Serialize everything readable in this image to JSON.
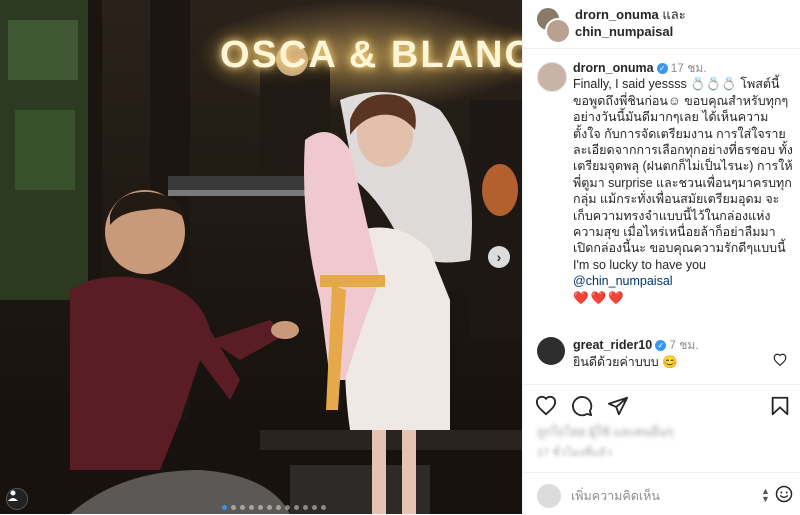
{
  "photo": {
    "sign_text": "OSCA & BLANC",
    "next_arrow": "›",
    "icons": [
      "chevron-right-icon",
      "user-tag-icon"
    ],
    "carousel_total": 12,
    "carousel_active": 1
  },
  "header": {
    "user1": "drorn_onuma",
    "connector": "และ",
    "user2": "chin_numpaisal"
  },
  "caption": {
    "username": "drorn_onuma",
    "time": "17 ชม.",
    "text": "Finally, I said yessss 💍💍💍 โพสต์นี้ขอพูดถึงพี่ชินก่อน☺ ขอบคุณสำหรับทุกๆอย่างวันนี้มันดีมากๆเลย ได้เห็นความตั้งใจ กับการจัดเตรียมงาน การใส่ใจรายละเอียดจากการเลือกทุกอย่างที่ธรชอบ ทั้งเตรียมจุดพลุ (ฝนตกก็ไม่เป็นไรนะ) การให้พี่ตูมา surprise และชวนเพื่อนๆมาครบทุกกลุ่ม แม้กระทั่งเพื่อนสมัยเตรียมอุดม จะเก็บความทรงจำแบบนี้ไว้ในกล่องแห่งความสุข เมื่อไหร่เหนื่อยล้าก็อย่าลืมมาเปิดกล่องนี้นะ ขอบคุณความรักดีๆแบบนี้ I'm so lucky to have you",
    "mention": "@chin_numpaisal",
    "hearts": "❤️❤️❤️"
  },
  "reply": {
    "username": "great_rider10",
    "time": "7 ชม.",
    "text": "ยินดีด้วยค่าบบบ 😊"
  },
  "actions": {
    "icons": [
      "heart-icon",
      "comment-icon",
      "share-icon",
      "bookmark-icon"
    ]
  },
  "likes_text": "ถูกใจโดย ผู้ใช้ และคนอื่นๆ",
  "date_text": "17 ชั่วโมงที่แล้ว",
  "comment_box": {
    "placeholder": "เพิ่มความคิดเห็น",
    "icons": [
      "sort-arrows-icon",
      "emoji-icon"
    ]
  },
  "colors": {
    "verified": "#3897f0",
    "link": "#00376b",
    "heart": "#e0245e"
  }
}
